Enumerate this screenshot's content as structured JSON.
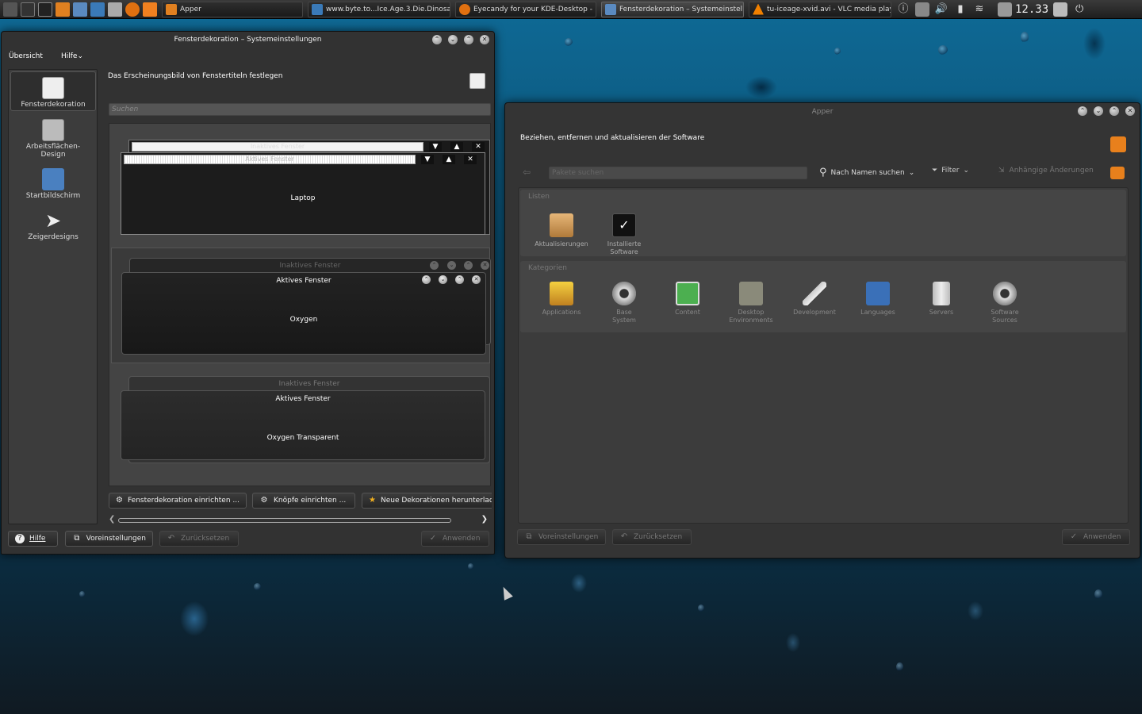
{
  "taskbar": {
    "tasks": [
      "Apper",
      "www.byte.to...Ice.Age.3.Die.Dinosau",
      "Eyecandy for your KDE-Desktop -",
      "Fensterdekoration – Systemeinstell",
      "tu-iceage-xvid.avi - VLC media play"
    ],
    "clock": "12.33"
  },
  "settings": {
    "title": "Fensterdekoration – Systemeinstellungen",
    "menu": [
      "Übersicht",
      "Hilfe"
    ],
    "heading": "Das Erscheinungsbild von Fenstertiteln festlegen",
    "search_placeholder": "Suchen",
    "sidebar": [
      "Fensterdekoration",
      "Arbeitsflächen-Design",
      "Startbildschirm",
      "Zeigerdesigns"
    ],
    "decorations": [
      {
        "inactive": "Inaktives Fenster",
        "active": "Aktives Fenster",
        "name": "Laptop"
      },
      {
        "inactive": "Inaktives Fenster",
        "active": "Aktives Fenster",
        "name": "Oxygen"
      },
      {
        "inactive": "Inaktives Fenster",
        "active": "Aktives Fenster",
        "name": "Oxygen Transparent"
      }
    ],
    "actions": [
      "Fensterdekoration einrichten ...",
      "Knöpfe einrichten ...",
      "Neue Dekorationen herunterladen"
    ],
    "bottom": [
      "Hilfe",
      "Voreinstellungen",
      "Zurücksetzen",
      "Anwenden"
    ]
  },
  "apper": {
    "title": "Apper",
    "heading": "Beziehen, entfernen und aktualisieren der Software",
    "search_placeholder": "Pakete suchen",
    "search_mode": "Nach Namen suchen",
    "filter": "Filter",
    "pending": "Anhängige Änderungen",
    "lists_label": "Listen",
    "lists": [
      "Aktualisierungen",
      "Installierte Software"
    ],
    "categories_label": "Kategorien",
    "categories": [
      "Applications",
      "Base System",
      "Content",
      "Desktop Environments",
      "Development",
      "Languages",
      "Servers",
      "Software Sources"
    ],
    "bottom": [
      "Voreinstellungen",
      "Zurücksetzen",
      "Anwenden"
    ]
  }
}
